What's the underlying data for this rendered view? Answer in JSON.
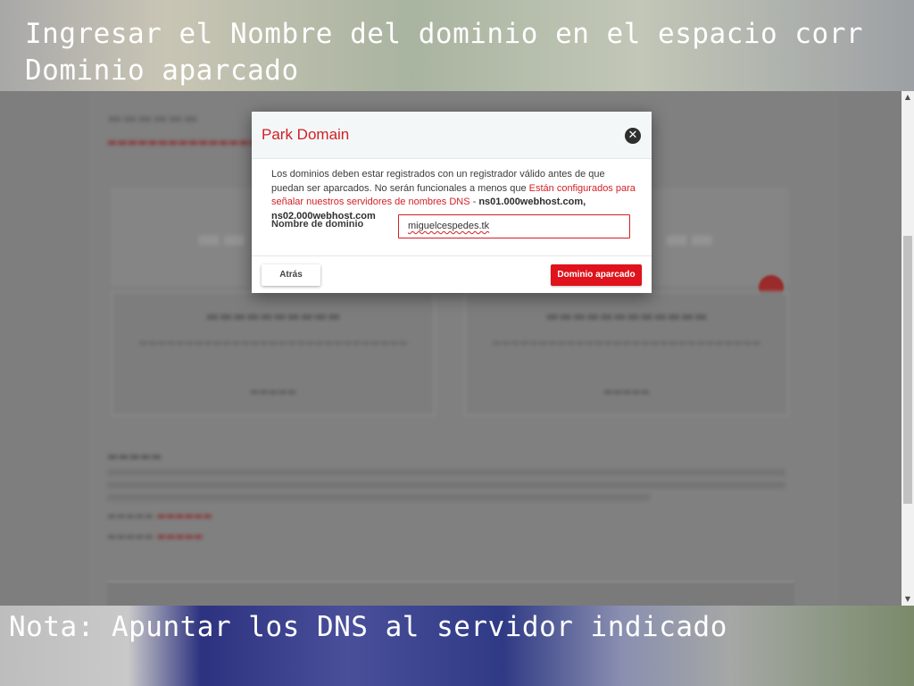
{
  "captions": {
    "top_line1": "Ingresar el Nombre del dominio en el espacio corr",
    "top_line2": "Dominio aparcado",
    "bottom": "Nota: Apuntar los DNS al servidor indicado"
  },
  "modal": {
    "title": "Park Domain",
    "close_icon": "close-icon",
    "description": {
      "text1": "Los dominios deben estar registrados con un registrador válido antes de que puedan ser aparcados. No serán funcionales a menos que ",
      "link": "Están configurados para señalar nuestros servidores de nombres DNS",
      "text2": " - ",
      "dns": "ns01.000webhost.com, ns02.000webhost.com"
    },
    "field_label": "Nombre de dominio",
    "field_value": "miguelcespedes.tk",
    "back_label": "Atrás",
    "park_label": "Dominio aparcado"
  },
  "colors": {
    "accent": "#d21f27",
    "button": "#e0121b"
  }
}
